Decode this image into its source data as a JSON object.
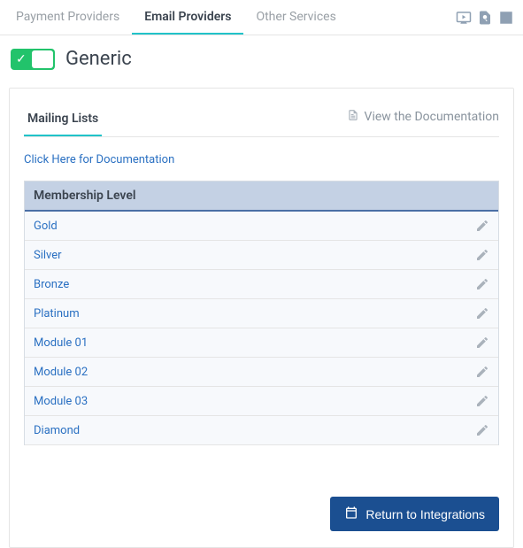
{
  "topTabs": {
    "payment": "Payment Providers",
    "email": "Email Providers",
    "other": "Other Services"
  },
  "provider": {
    "name": "Generic"
  },
  "subTabs": {
    "mailing": "Mailing Lists"
  },
  "docTop": "View the Documentation",
  "docLink": "Click Here for Documentation",
  "table": {
    "header": "Membership Level",
    "rows": [
      {
        "name": "Gold"
      },
      {
        "name": "Silver"
      },
      {
        "name": "Bronze"
      },
      {
        "name": "Platinum"
      },
      {
        "name": "Module 01"
      },
      {
        "name": "Module 02"
      },
      {
        "name": "Module 03"
      },
      {
        "name": "Diamond"
      }
    ]
  },
  "returnBtn": "Return to Integrations"
}
